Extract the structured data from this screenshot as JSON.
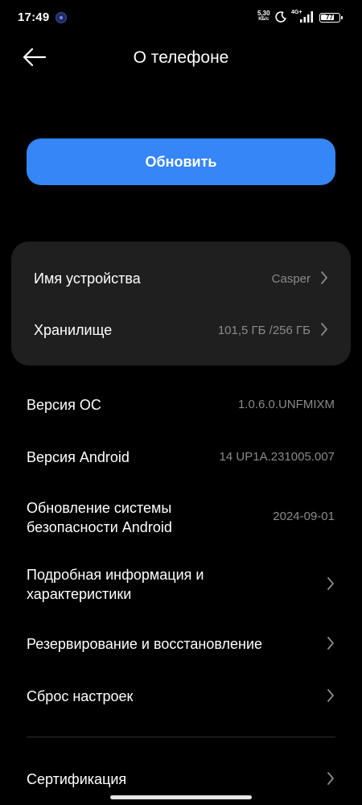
{
  "status_bar": {
    "time": "17:49",
    "speed_value": "5,30",
    "speed_unit": "КБ/с",
    "network": "4G+",
    "battery": "77",
    "battery_level": 0.77
  },
  "header": {
    "title": "О телефоне",
    "back_icon": "arrow-left-icon"
  },
  "update_button": {
    "label": "Обновить",
    "color": "#3586f7"
  },
  "card": {
    "device_name": {
      "label": "Имя устройства",
      "value": "Casper"
    },
    "storage": {
      "label": "Хранилище",
      "value": "101,5 ГБ /256 ГБ"
    }
  },
  "list": {
    "os_version": {
      "label": "Версия ОС",
      "value": "1.0.6.0.UNFMIXM"
    },
    "android_version": {
      "label": "Версия Android",
      "value": "14 UP1A.231005.007"
    },
    "security_update": {
      "label_line1": "Обновление системы",
      "label_line2": "безопасности Android",
      "value": "2024-09-01"
    },
    "details": {
      "label_line1": "Подробная информация и",
      "label_line2": "характеристики"
    },
    "backup": {
      "label": "Резервирование и восстановление"
    },
    "reset": {
      "label": "Сброс настроек"
    },
    "certification": {
      "label": "Сертификация"
    }
  }
}
